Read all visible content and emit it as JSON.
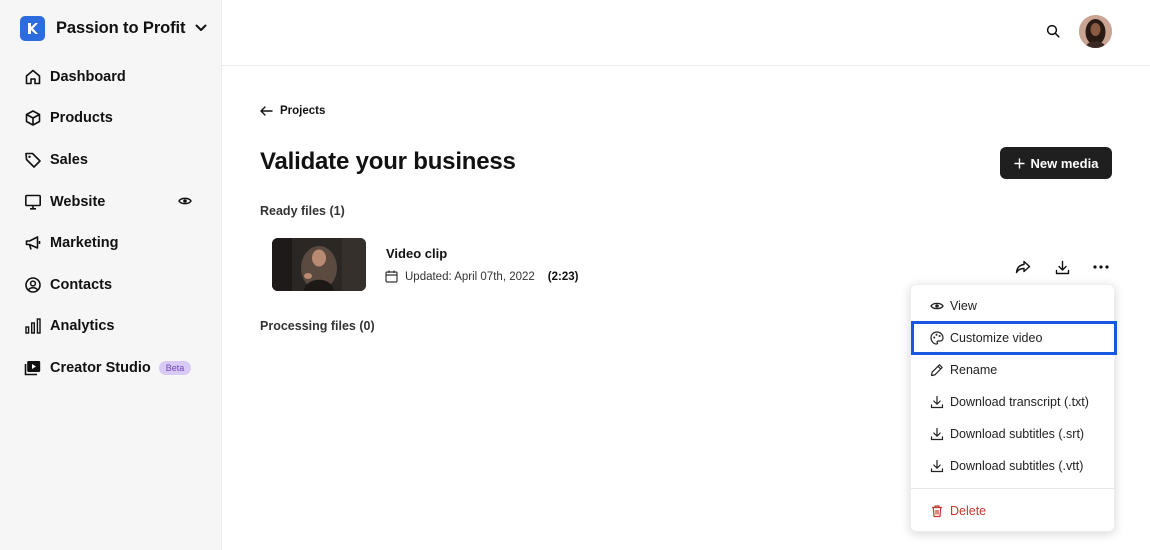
{
  "workspace": {
    "name": "Passion to Profit"
  },
  "sidebar": {
    "items": [
      {
        "label": "Dashboard",
        "icon": "home-icon"
      },
      {
        "label": "Products",
        "icon": "box-icon"
      },
      {
        "label": "Sales",
        "icon": "tag-icon"
      },
      {
        "label": "Website",
        "icon": "monitor-icon"
      },
      {
        "label": "Marketing",
        "icon": "megaphone-icon"
      },
      {
        "label": "Contacts",
        "icon": "user-circle-icon"
      },
      {
        "label": "Analytics",
        "icon": "bar-chart-icon"
      },
      {
        "label": "Creator Studio",
        "icon": "play-icon",
        "badge": "Beta"
      }
    ]
  },
  "header": {
    "back_label": "Projects",
    "title": "Validate your business",
    "new_media_label": "New media"
  },
  "sections": {
    "ready": "Ready files (1)",
    "processing": "Processing files (0)"
  },
  "file": {
    "name": "Video clip",
    "updated": "Updated: April 07th, 2022",
    "duration": "(2:23)"
  },
  "menu": {
    "items": [
      {
        "label": "View",
        "icon": "eye-icon"
      },
      {
        "label": "Customize video",
        "icon": "palette-icon"
      },
      {
        "label": "Rename",
        "icon": "pencil-icon"
      },
      {
        "label": "Download transcript (.txt)",
        "icon": "download-icon"
      },
      {
        "label": "Download subtitles (.srt)",
        "icon": "download-icon"
      },
      {
        "label": "Download subtitles (.vtt)",
        "icon": "download-icon"
      },
      {
        "label": "Delete",
        "icon": "trash-icon"
      }
    ]
  },
  "colors": {
    "brand": "#2d6cdf",
    "highlight": "#1a57e0",
    "danger": "#c8372d",
    "beta_bg": "#d9c9f5"
  }
}
